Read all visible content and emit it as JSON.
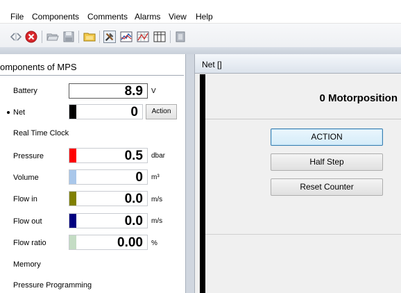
{
  "menu": [
    "File",
    "Components",
    "Comments",
    "Alarms",
    "View",
    "Help"
  ],
  "toolbar": {
    "icons": [
      "arrows-icon",
      "stop-icon",
      "open-folder-icon",
      "save-icon",
      "folder-icon",
      "tools-icon",
      "chart-icon",
      "grid-chart-icon",
      "table-icon",
      "info-icon"
    ]
  },
  "left_panel": {
    "title": "omponents of MPS",
    "rows": [
      {
        "label": "Battery",
        "value": "8.9",
        "unit": "V",
        "swatch": ""
      },
      {
        "label": "Net",
        "value": "0",
        "unit": "",
        "swatch": "#000000",
        "action_label": "Action"
      },
      {
        "label": "Real Time Clock"
      },
      {
        "label": "Pressure",
        "value": "0.5",
        "unit": "dbar",
        "swatch": "#ff0000"
      },
      {
        "label": "Volume",
        "value": "0",
        "unit": "m³",
        "swatch": "#a9c7ea"
      },
      {
        "label": "Flow in",
        "value": "0.0",
        "unit": "m/s",
        "swatch": "#808000"
      },
      {
        "label": "Flow out",
        "value": "0.0",
        "unit": "m/s",
        "swatch": "#000080"
      },
      {
        "label": "Flow ratio",
        "value": "0.00",
        "unit": "%",
        "swatch": "#c4dcc4"
      },
      {
        "label": "Memory"
      },
      {
        "label": "Pressure Programming"
      }
    ]
  },
  "right_panel": {
    "title": "Net []",
    "motor_position": "0 Motorposition",
    "buttons": [
      "ACTION",
      "Half Step",
      "Reset Counter"
    ]
  }
}
